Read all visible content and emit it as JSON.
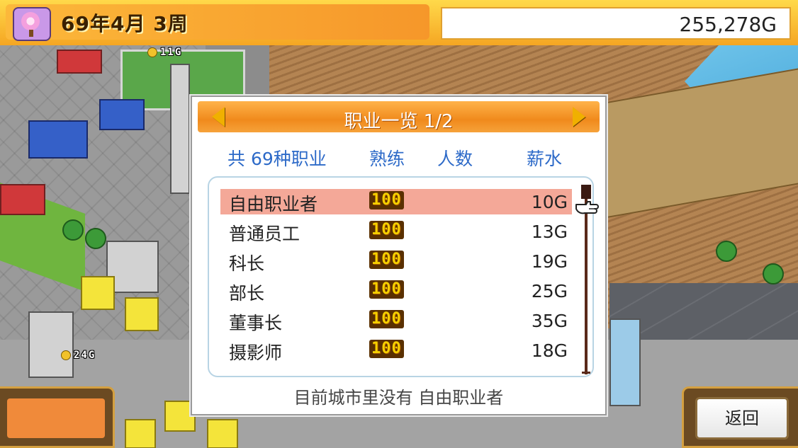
{
  "topbar": {
    "date": "69年4月 3周",
    "money": "255,278G"
  },
  "map_labels": {
    "coin_top": "11G",
    "coin_left": "24G"
  },
  "dialog": {
    "title": "职业一览 1/2",
    "columns": {
      "jobs": "共 69种职业",
      "skill": "熟练",
      "count": "人数",
      "salary": "薪水"
    },
    "rows": [
      {
        "name": "自由职业者",
        "skill": "100",
        "count": "",
        "salary": "10G",
        "selected": true
      },
      {
        "name": "普通员工",
        "skill": "100",
        "count": "",
        "salary": "13G"
      },
      {
        "name": "科长",
        "skill": "100",
        "count": "",
        "salary": "19G"
      },
      {
        "name": "部长",
        "skill": "100",
        "count": "",
        "salary": "25G"
      },
      {
        "name": "董事长",
        "skill": "100",
        "count": "",
        "salary": "35G"
      },
      {
        "name": "摄影师",
        "skill": "100",
        "count": "",
        "salary": "18G"
      }
    ],
    "status": "目前城市里没有 自由职业者"
  },
  "buttons": {
    "back": "返回"
  },
  "colors": {
    "header_orange": "#f08a1c",
    "column_blue": "#2d6ac8",
    "selected_row": "#f4a898"
  },
  "icons": {
    "season": "cherry-blossom-icon",
    "prev": "arrow-left-icon",
    "next": "arrow-right-icon",
    "cursor": "pointing-hand-icon"
  }
}
